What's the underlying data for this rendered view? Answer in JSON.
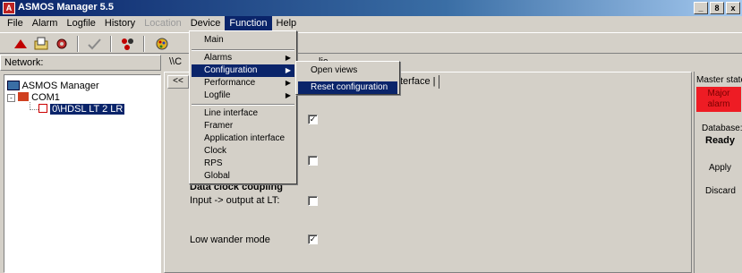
{
  "window": {
    "title": "ASMOS Manager 5.5",
    "minimize": "_",
    "restore": "8",
    "close": "x"
  },
  "menubar": {
    "file": "File",
    "alarm": "Alarm",
    "logfile": "Logfile",
    "history": "History",
    "location": "Location",
    "device": "Device",
    "function": "Function",
    "help": "Help"
  },
  "toolbar": {
    "icons": [
      "up-arrow-icon",
      "open-folder-icon",
      "gear-icon",
      "check-icon",
      "chart-icon",
      "palette-icon"
    ]
  },
  "network": {
    "header": "Network:",
    "tree": {
      "root": "ASMOS Manager",
      "com": "COM1",
      "device": "0\\HDSL LT 2 LR"
    }
  },
  "tabs": {
    "tab1": "\\\\C",
    "tab2": "lic |",
    "subtab_nav": "<<",
    "subtab": "terface |"
  },
  "form": {
    "section": "Data clock coupling",
    "input_output_label": "Input -> output at LT:",
    "low_wander_label": "Low wander mode",
    "checkbox_mark": "✓"
  },
  "status": {
    "master_state_label": "Master state",
    "master_state_value": "Major alarm",
    "database_label": "Database:",
    "database_value": "Ready",
    "apply": "Apply",
    "discard": "Discard"
  },
  "function_menu": {
    "main": "Main",
    "alarms": "Alarms",
    "configuration": "Configuration",
    "performance": "Performance",
    "logfile": "Logfile",
    "line_interface": "Line interface",
    "framer": "Framer",
    "application_interface": "Application interface",
    "clock": "Clock",
    "rps": "RPS",
    "global": "Global"
  },
  "config_submenu": {
    "open_views": "Open views",
    "reset_configuration": "Reset configuration"
  },
  "colors": {
    "highlight": "#0a246a",
    "alarm": "#ee1c24",
    "face": "#d4d0c8"
  }
}
